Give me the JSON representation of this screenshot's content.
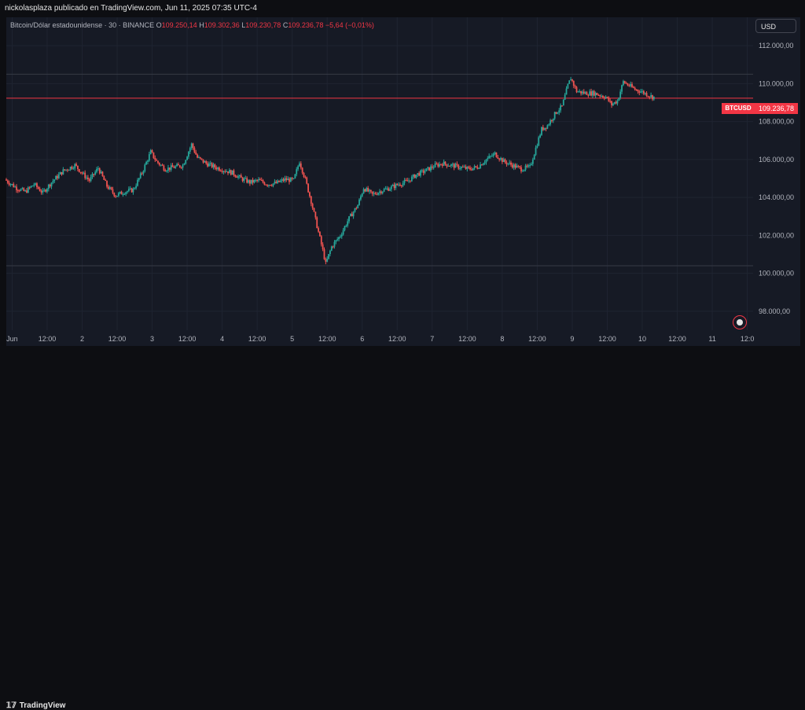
{
  "header": {
    "published_text": "nickolasplaza publicado en TradingView.com, Jun 11, 2025 07:35 UTC-4"
  },
  "legend": {
    "symbol": "Bitcoin/Dólar estadounidense · 30 · BINANCE",
    "o_label": "O",
    "o_value": "109.250,14",
    "h_label": "H",
    "h_value": "109.302,36",
    "l_label": "L",
    "l_value": "109.230,78",
    "c_label": "C",
    "c_value": "109.236,78",
    "change": "−5,64 (−0,01%)"
  },
  "currency_button": "USD",
  "price_marker": {
    "ticker": "BTCUSD",
    "price": "109.236,78"
  },
  "footer": {
    "logo_mark": "𝟙𝟟",
    "logo_text": "TradingView"
  },
  "colors": {
    "up": "#26a69a",
    "down": "#ef5350",
    "accent": "#f23645",
    "background": "#161a25"
  },
  "chart_data": {
    "type": "candlestick",
    "y_ticks": [
      "112.000,00",
      "110.000,00",
      "108.000,00",
      "106.000,00",
      "104.000,00",
      "102.000,00",
      "100.000,00",
      "98.000,00"
    ],
    "y_tick_values": [
      112000,
      110000,
      108000,
      106000,
      104000,
      102000,
      100000,
      98000
    ],
    "ylim": [
      97000,
      113500
    ],
    "x_ticks": [
      "Jun",
      "12:00",
      "2",
      "12:00",
      "3",
      "12:00",
      "4",
      "12:00",
      "5",
      "12:00",
      "6",
      "12:00",
      "7",
      "12:00",
      "8",
      "12:00",
      "9",
      "12:00",
      "10",
      "12:00",
      "11",
      "12:0"
    ],
    "x_tick_hours": [
      0,
      12,
      24,
      36,
      48,
      60,
      72,
      84,
      96,
      108,
      120,
      132,
      144,
      156,
      168,
      180,
      192,
      204,
      216,
      228,
      240,
      252
    ],
    "x_range_hours": [
      -2,
      254
    ],
    "current_price": 109236.78,
    "horizontal_levels": [
      110500,
      109236.78,
      100400
    ],
    "price_path": [
      [
        -2,
        104950
      ],
      [
        2,
        104500
      ],
      [
        5,
        104300
      ],
      [
        8,
        104700
      ],
      [
        11,
        104250
      ],
      [
        14,
        104800
      ],
      [
        18,
        105400
      ],
      [
        22,
        105700
      ],
      [
        25,
        105200
      ],
      [
        27,
        104900
      ],
      [
        30,
        105550
      ],
      [
        33,
        104600
      ],
      [
        36,
        104100
      ],
      [
        39,
        104300
      ],
      [
        42,
        104400
      ],
      [
        45,
        105300
      ],
      [
        48,
        106400
      ],
      [
        50,
        105900
      ],
      [
        53,
        105500
      ],
      [
        56,
        105600
      ],
      [
        59,
        105700
      ],
      [
        62,
        106800
      ],
      [
        64,
        106100
      ],
      [
        67,
        105800
      ],
      [
        70,
        105600
      ],
      [
        73,
        105450
      ],
      [
        76,
        105300
      ],
      [
        79,
        105000
      ],
      [
        82,
        104800
      ],
      [
        85,
        104900
      ],
      [
        88,
        104700
      ],
      [
        91,
        104750
      ],
      [
        94,
        104950
      ],
      [
        97,
        104900
      ],
      [
        99,
        105900
      ],
      [
        101,
        104950
      ],
      [
        103,
        103800
      ],
      [
        105,
        102500
      ],
      [
        107,
        101200
      ],
      [
        108,
        100500
      ],
      [
        110,
        101400
      ],
      [
        113,
        102000
      ],
      [
        116,
        102900
      ],
      [
        119,
        103600
      ],
      [
        121,
        104500
      ],
      [
        124,
        104150
      ],
      [
        127,
        104350
      ],
      [
        130,
        104500
      ],
      [
        133,
        104700
      ],
      [
        136,
        104850
      ],
      [
        139,
        105200
      ],
      [
        142,
        105400
      ],
      [
        145,
        105650
      ],
      [
        148,
        105800
      ],
      [
        151,
        105700
      ],
      [
        154,
        105600
      ],
      [
        157,
        105500
      ],
      [
        160,
        105600
      ],
      [
        163,
        106000
      ],
      [
        166,
        106300
      ],
      [
        169,
        105900
      ],
      [
        172,
        105700
      ],
      [
        175,
        105500
      ],
      [
        178,
        105600
      ],
      [
        180,
        106600
      ],
      [
        182,
        107600
      ],
      [
        184,
        107800
      ],
      [
        187,
        108500
      ],
      [
        189,
        108800
      ],
      [
        191,
        109900
      ],
      [
        192,
        110300
      ],
      [
        194,
        109600
      ],
      [
        197,
        109500
      ],
      [
        200,
        109500
      ],
      [
        202,
        109400
      ],
      [
        204,
        109300
      ],
      [
        206,
        108900
      ],
      [
        208,
        109100
      ],
      [
        210,
        110100
      ],
      [
        212,
        109900
      ],
      [
        214,
        109700
      ],
      [
        216,
        109600
      ],
      [
        218,
        109450
      ],
      [
        220,
        109300
      ]
    ]
  }
}
